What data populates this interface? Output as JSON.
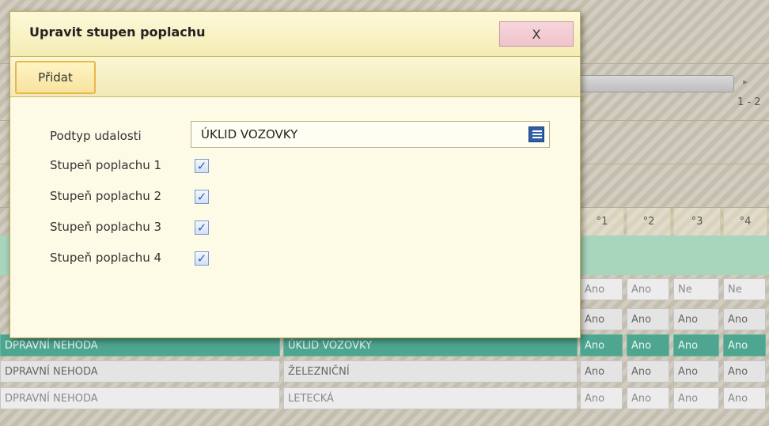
{
  "background": {
    "paging": "1 - 2",
    "column_headers": [
      "°1",
      "°2",
      "°3",
      "°4"
    ],
    "rows": [
      {
        "type": "",
        "subtype": "",
        "alarms": [
          "Ano",
          "Ano",
          "Ne",
          "Ne"
        ]
      },
      {
        "type": "",
        "subtype": "",
        "alarms": [
          "Ano",
          "Ano",
          "Ano",
          "Ano"
        ]
      },
      {
        "type": "DPRAVNÍ NEHODA",
        "subtype": "ÚKLID VOZOVKY",
        "alarms": [
          "Ano",
          "Ano",
          "Ano",
          "Ano"
        ]
      },
      {
        "type": "DPRAVNÍ NEHODA",
        "subtype": "ŽELEZNIČNÍ",
        "alarms": [
          "Ano",
          "Ano",
          "Ano",
          "Ano"
        ]
      },
      {
        "type": "DPRAVNÍ NEHODA",
        "subtype": "LETECKÁ",
        "alarms": [
          "Ano",
          "Ano",
          "Ano",
          "Ano"
        ]
      }
    ],
    "selected_row_color": "#4ea691"
  },
  "dialog": {
    "title": "Upravit stupen poplachu",
    "close_label": "X",
    "add_label": "Přidat",
    "subtype_label": "Podtyp udalosti",
    "subtype_value": "ÚKLID VOZOVKY",
    "subtype_icon": "list-icon",
    "checkboxes": [
      {
        "label": "Stupeň poplachu 1",
        "checked": true
      },
      {
        "label": "Stupeň poplachu 2",
        "checked": true
      },
      {
        "label": "Stupeň poplachu 3",
        "checked": true
      },
      {
        "label": "Stupeň poplachu 4",
        "checked": true
      }
    ],
    "accent_color": "#eab64a",
    "close_color": "#f7d5dc"
  }
}
